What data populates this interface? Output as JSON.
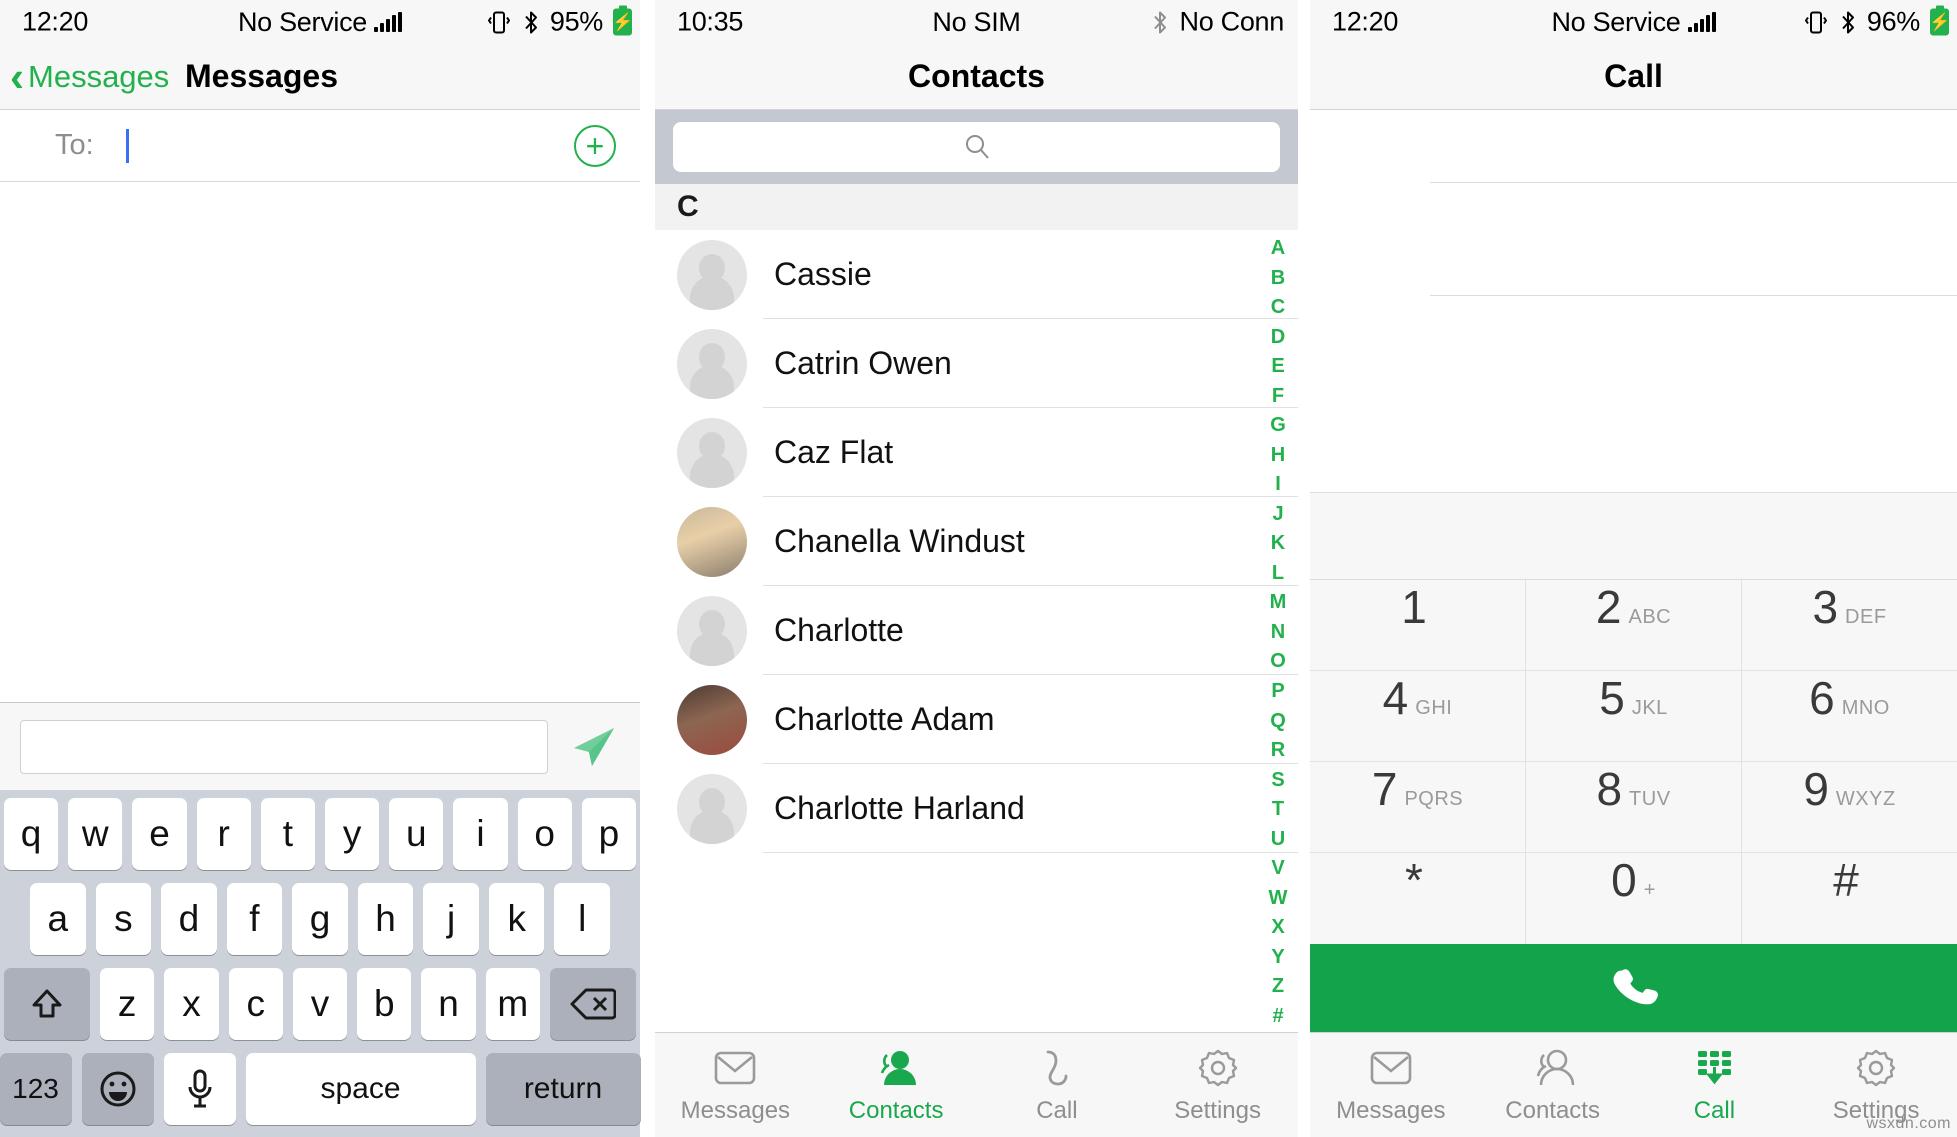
{
  "panels": {
    "messages": {
      "status": {
        "time": "12:20",
        "carrier": "No Service",
        "battery": "95%",
        "vibrate_icon": "vibrate-icon",
        "bluetooth_icon": "bluetooth-icon",
        "battery_icon": "battery-charging-icon"
      },
      "nav": {
        "back_label": "Messages",
        "title": "Messages",
        "back_icon": "chevron-left-icon"
      },
      "to_row": {
        "label": "To:",
        "value": "",
        "add_contact_icon": "plus-circle-icon"
      },
      "compose": {
        "value": "",
        "placeholder": "",
        "send_icon": "send-paper-plane-icon"
      },
      "keyboard": {
        "row1": [
          "q",
          "w",
          "e",
          "r",
          "t",
          "y",
          "u",
          "i",
          "o",
          "p"
        ],
        "row2": [
          "a",
          "s",
          "d",
          "f",
          "g",
          "h",
          "j",
          "k",
          "l"
        ],
        "row3": [
          "z",
          "x",
          "c",
          "v",
          "b",
          "n",
          "m"
        ],
        "shift_icon": "shift-up-arrow-icon",
        "backspace_icon": "backspace-delete-icon",
        "numbers_label": "123",
        "emoji_icon": "smiley-face-icon",
        "mic_icon": "microphone-icon",
        "space_label": "space",
        "return_label": "return"
      }
    },
    "contacts": {
      "status": {
        "time": "10:35",
        "carrier": "No SIM",
        "right": "No Conn",
        "bluetooth_icon": "bluetooth-icon"
      },
      "nav": {
        "title": "Contacts"
      },
      "search": {
        "value": "",
        "placeholder": "",
        "icon": "search-magnifier-icon"
      },
      "section_header": "C",
      "items": [
        {
          "name": "Cassie",
          "avatar": "placeholder"
        },
        {
          "name": "Catrin Owen",
          "avatar": "placeholder"
        },
        {
          "name": "Caz Flat",
          "avatar": "placeholder"
        },
        {
          "name": "Chanella Windust",
          "avatar": "photo1"
        },
        {
          "name": "Charlotte",
          "avatar": "placeholder"
        },
        {
          "name": "Charlotte Adam",
          "avatar": "photo2"
        },
        {
          "name": "Charlotte Harland",
          "avatar": "placeholder"
        }
      ],
      "index": [
        "A",
        "B",
        "C",
        "D",
        "E",
        "F",
        "G",
        "H",
        "I",
        "J",
        "K",
        "L",
        "M",
        "N",
        "O",
        "P",
        "Q",
        "R",
        "S",
        "T",
        "U",
        "V",
        "W",
        "X",
        "Y",
        "Z",
        "#"
      ],
      "tabs": [
        {
          "label": "Messages",
          "icon": "envelope-icon",
          "active": false
        },
        {
          "label": "Contacts",
          "icon": "people-icon",
          "active": true
        },
        {
          "label": "Call",
          "icon": "phone-handset-icon",
          "active": false
        },
        {
          "label": "Settings",
          "icon": "gear-icon",
          "active": false
        }
      ]
    },
    "call": {
      "status": {
        "time": "12:20",
        "carrier": "No Service",
        "battery": "96%",
        "vibrate_icon": "vibrate-icon",
        "bluetooth_icon": "bluetooth-icon",
        "battery_icon": "battery-charging-icon"
      },
      "nav": {
        "title": "Call"
      },
      "number_display": "",
      "dialpad": [
        [
          {
            "num": "1",
            "letters": ""
          },
          {
            "num": "2",
            "letters": "ABC"
          },
          {
            "num": "3",
            "letters": "DEF"
          }
        ],
        [
          {
            "num": "4",
            "letters": "GHI"
          },
          {
            "num": "5",
            "letters": "JKL"
          },
          {
            "num": "6",
            "letters": "MNO"
          }
        ],
        [
          {
            "num": "7",
            "letters": "PQRS"
          },
          {
            "num": "8",
            "letters": "TUV"
          },
          {
            "num": "9",
            "letters": "WXYZ"
          }
        ],
        [
          {
            "num": "*",
            "letters": ""
          },
          {
            "num": "0",
            "letters": "+"
          },
          {
            "num": "#",
            "letters": ""
          }
        ]
      ],
      "call_button_icon": "phone-handset-filled-icon",
      "tabs": [
        {
          "label": "Messages",
          "icon": "envelope-icon",
          "active": false
        },
        {
          "label": "Contacts",
          "icon": "people-icon",
          "active": false
        },
        {
          "label": "Call",
          "icon": "dialpad-down-arrow-icon",
          "active": true
        },
        {
          "label": "Settings",
          "icon": "gear-icon",
          "active": false
        }
      ],
      "watermark": "wsxdn.com"
    }
  },
  "colors": {
    "accent_green": "#22b14c",
    "call_green": "#13a34a",
    "tab_inactive": "#8e8e8e",
    "keyboard_bg": "#cdd1d9"
  }
}
